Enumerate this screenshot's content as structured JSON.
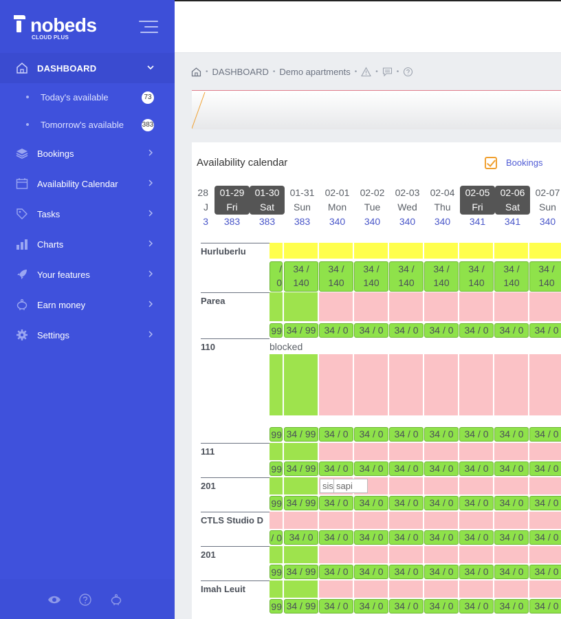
{
  "brand": {
    "name": "nobeds",
    "sub": "CLOUD PLUS"
  },
  "sidebar": {
    "dashboard_label": "DASHBOARD",
    "subitems": [
      {
        "label": "Today's available",
        "badge": "73"
      },
      {
        "label": "Tomorrow's available",
        "badge": "383"
      }
    ],
    "items": [
      {
        "label": "Bookings",
        "icon": "layers-icon"
      },
      {
        "label": "Availability Calendar",
        "icon": "calendar-icon"
      },
      {
        "label": "Tasks",
        "icon": "tag-icon"
      },
      {
        "label": "Charts",
        "icon": "bar-chart-icon"
      },
      {
        "label": "Your features",
        "icon": "rocket-icon"
      },
      {
        "label": "Earn money",
        "icon": "piggy-bank-icon"
      },
      {
        "label": "Settings",
        "icon": "gear-icon"
      }
    ],
    "footer_icons": [
      "eye-icon",
      "help-icon",
      "piggy-bank-icon"
    ]
  },
  "breadcrumb": {
    "root": "DASHBOARD",
    "current": "Demo apartments"
  },
  "calendar": {
    "title": "Availability calendar",
    "bookings_toggle": "Bookings",
    "partial_day": {
      "date": "28",
      "dow": "J",
      "avail": "3"
    },
    "days": [
      {
        "date": "01-29",
        "dow": "Fri",
        "avail": "383",
        "weekend": true
      },
      {
        "date": "01-30",
        "dow": "Sat",
        "avail": "383",
        "weekend": true
      },
      {
        "date": "01-31",
        "dow": "Sun",
        "avail": "383",
        "weekend": false
      },
      {
        "date": "02-01",
        "dow": "Mon",
        "avail": "340",
        "weekend": false
      },
      {
        "date": "02-02",
        "dow": "Tue",
        "avail": "340",
        "weekend": false
      },
      {
        "date": "02-03",
        "dow": "Wed",
        "avail": "340",
        "weekend": false
      },
      {
        "date": "02-04",
        "dow": "Thu",
        "avail": "340",
        "weekend": false
      },
      {
        "date": "02-05",
        "dow": "Fri",
        "avail": "341",
        "weekend": true
      },
      {
        "date": "02-06",
        "dow": "Sat",
        "avail": "341",
        "weekend": true
      },
      {
        "date": "02-07",
        "dow": "Sun",
        "avail": "340",
        "weekend": false
      }
    ],
    "rooms": [
      {
        "name": "Hurluberlu",
        "partial_value": "/\n0",
        "values": [
          "34 /\n140",
          "34 /\n140",
          "34 /\n140",
          "34 /\n140",
          "34 /\n140",
          "34 /\n140",
          "34 /\n140",
          "34 /\n140"
        ]
      },
      {
        "name": "Parea",
        "partial_value": "99",
        "values": [
          "34 / 99",
          "34 / 0",
          "34 / 0",
          "34 / 0",
          "34 / 0",
          "34 / 0",
          "34 / 0",
          "34 / 0"
        ]
      },
      {
        "name": "110",
        "note": "blocked",
        "partial_value": "99",
        "values": [
          "34 / 99",
          "34 / 0",
          "34 / 0",
          "34 / 0",
          "34 / 0",
          "34 / 0",
          "34 / 0",
          "34 / 0"
        ]
      },
      {
        "name": "111",
        "partial_value": "99",
        "values": [
          "34 / 99",
          "34 / 0",
          "34 / 0",
          "34 / 0",
          "34 / 0",
          "34 / 0",
          "34 / 0",
          "34 / 0"
        ]
      },
      {
        "name": "201",
        "partial_value": "99",
        "values": [
          "34 / 99",
          "34 / 0",
          "34 / 0",
          "34 / 0",
          "34 / 0",
          "34 / 0",
          "34 / 0",
          "34 / 0"
        ],
        "tags": [
          "sis",
          "sapi"
        ]
      },
      {
        "name": "CTLS Studio D",
        "partial_value": "/ 0",
        "values": [
          "34 / 0",
          "34 / 0",
          "34 / 0",
          "34 / 0",
          "34 / 0",
          "34 / 0",
          "34 / 0",
          "34 / 0"
        ]
      },
      {
        "name": "201",
        "partial_value": "99",
        "values": [
          "34 / 99",
          "34 / 0",
          "34 / 0",
          "34 / 0",
          "34 / 0",
          "34 / 0",
          "34 / 0",
          "34 / 0"
        ]
      },
      {
        "name": "Imah Leuit",
        "partial_value": "99",
        "values": [
          "34 / 99",
          "34 / 0",
          "34 / 0",
          "34 / 0",
          "34 / 0",
          "34 / 0",
          "34 / 0",
          "34 / 0"
        ]
      }
    ]
  }
}
